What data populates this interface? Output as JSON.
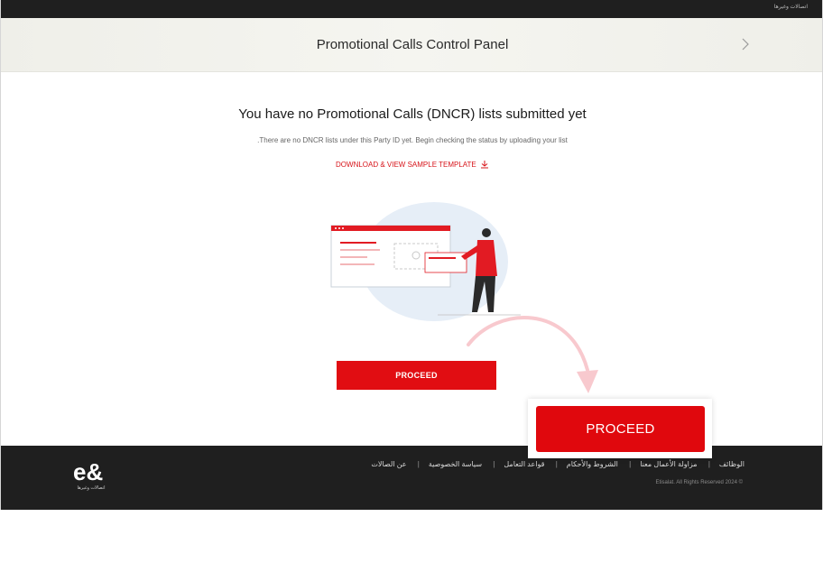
{
  "topbar": {
    "brand_mini": "اتصالات وغيرها"
  },
  "panel": {
    "title": "Promotional Calls Control Panel",
    "chevron_icon": "chevron-right-icon"
  },
  "main": {
    "heading": "You have no Promotional Calls (DNCR) lists submitted yet",
    "subtext": ".There are no DNCR lists under this Party ID yet. Begin checking the status by uploading your list",
    "download_label": "DOWNLOAD & VIEW SAMPLE TEMPLATE",
    "download_icon": "download-icon",
    "proceed_label": "PROCEED"
  },
  "footer": {
    "logo_caption": "اتصالات وغيرها",
    "links": [
      "عن الصالات",
      "سياسة الخصوصية",
      "قواعد التعامل",
      "الشروط والأحكام",
      "مزاولة الأعمال معنا",
      "الوظائف"
    ],
    "copyright": "Etisalat. All Rights Reserved 2024 ©"
  },
  "callout": {
    "proceed_label": "PROCEED"
  },
  "colors": {
    "accent": "#e10d12",
    "dark": "#1f1f1f",
    "panel_bg": "#f2f2ec"
  }
}
